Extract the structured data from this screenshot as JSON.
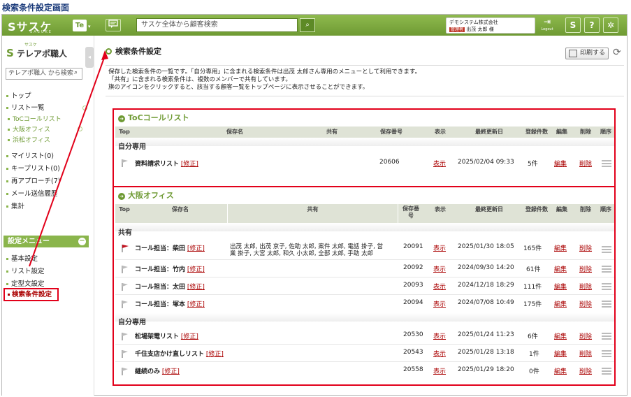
{
  "page_title": "検索条件設定画面",
  "topbar": {
    "logo": "Sサスケ",
    "logo_sub": "SASUKE",
    "te_label": "Te",
    "te_caret": "▾",
    "chat_icon": "chat-icon",
    "search_placeholder": "サスケ全体から顧客検索",
    "search_icon": "⌕",
    "company": "デモシステム株式会社",
    "user_badge": "管理者",
    "user_name": "出茂 太郎 様",
    "logout": "Logout",
    "logout_icon": "⇥",
    "s_icon": "S",
    "help_icon": "?",
    "settings_icon": "✲"
  },
  "sidebar": {
    "app_small": "サスケ",
    "app_name": "テレアポ職人",
    "collapse": "◂",
    "search_placeholder": "テレアポ職人 から検索",
    "items": [
      {
        "label": "トップ"
      },
      {
        "label": "リスト一覧"
      },
      {
        "label": "マイリスト(0)"
      },
      {
        "label": "キープリスト(0)"
      },
      {
        "label": "再アプローチ(7)"
      },
      {
        "label": "メール送信履歴"
      },
      {
        "label": "集計"
      }
    ],
    "sublists": [
      {
        "label": "ToCコールリスト"
      },
      {
        "label": "大阪オフィス"
      },
      {
        "label": "浜松オフィス"
      }
    ],
    "menu_header": "設定メニュー",
    "menu_collapse": "−",
    "menu_items": [
      {
        "label": "基本設定"
      },
      {
        "label": "リスト設定"
      },
      {
        "label": "定型文設定"
      }
    ],
    "active_item": "検索条件設定"
  },
  "main": {
    "heading": "検索条件設定",
    "print_label": "印刷する",
    "refresh_icon": "⟳",
    "desc": [
      "保存した検索条件の一覧です。「自分専用」に含まれる検索条件は出茂 太郎さん専用のメニューとして利用できます。",
      "「共有」に含まれる検索条件は、複数のメンバーで共有しています。",
      "旗のアイコンをクリックすると、該当する顧客一覧をトップページに表示させることができます。"
    ]
  },
  "panel1": {
    "title": "ToCコールリスト",
    "arrow": "➔",
    "headers": [
      "Top",
      "保存名",
      "共有",
      "保存番号",
      "表示",
      "最終更新日",
      "登録件数",
      "編集",
      "削除",
      "順序"
    ],
    "group": "自分専用",
    "rows": [
      {
        "name": "資料請求リスト",
        "edit": "[修正]",
        "shared": "",
        "id": "20606",
        "show": "表示",
        "date": "2025/02/04 09:33",
        "count": "5件",
        "edit_link": "編集",
        "del": "削除",
        "flag": "grey"
      }
    ]
  },
  "panel2": {
    "title": "大阪オフィス",
    "arrow": "➔",
    "headers": [
      "Top",
      "保存名",
      "共有",
      "保存番号",
      "表示",
      "最終更新日",
      "登録件数",
      "編集",
      "削除",
      "順序"
    ],
    "group_shared": "共有",
    "group_own": "自分専用",
    "shared_rows": [
      {
        "name": "コール担当：柴田",
        "edit": "[修正]",
        "shared1": "出茂 太郎, 出茂 京子, 佐助 太郎, 案件 太郎, 電話 掛子, 営",
        "shared2": "業 掛子, 大宮 太郎, 和久 小太郎, 全部 太郎, 手助 太郎",
        "id": "20091",
        "show": "表示",
        "date": "2025/01/30 18:05",
        "count": "165件",
        "edit_link": "編集",
        "del": "削除",
        "flag": "red"
      },
      {
        "name": "コール担当：竹内",
        "edit": "[修正]",
        "shared1": "",
        "shared2": "",
        "id": "20092",
        "show": "表示",
        "date": "2024/09/30 14:20",
        "count": "61件",
        "edit_link": "編集",
        "del": "削除",
        "flag": "grey"
      },
      {
        "name": "コール担当：太田",
        "edit": "[修正]",
        "shared1": "",
        "shared2": "",
        "id": "20093",
        "show": "表示",
        "date": "2024/12/18 18:29",
        "count": "111件",
        "edit_link": "編集",
        "del": "削除",
        "flag": "grey"
      },
      {
        "name": "コール担当：塚本",
        "edit": "[修正]",
        "shared1": "",
        "shared2": "",
        "id": "20094",
        "show": "表示",
        "date": "2024/07/08 10:49",
        "count": "175件",
        "edit_link": "編集",
        "del": "削除",
        "flag": "grey"
      }
    ],
    "own_rows": [
      {
        "name": "松場架電リスト",
        "edit": "[修正]",
        "id": "20530",
        "show": "表示",
        "date": "2025/01/24 11:23",
        "count": "6件",
        "edit_link": "編集",
        "del": "削除",
        "flag": "grey"
      },
      {
        "name": "千住支店かけ直しリスト",
        "edit": "[修正]",
        "id": "20543",
        "show": "表示",
        "date": "2025/01/28 13:18",
        "count": "1件",
        "edit_link": "編集",
        "del": "削除",
        "flag": "grey"
      },
      {
        "name": "継続のみ",
        "edit": "[修正]",
        "id": "20558",
        "show": "表示",
        "date": "2025/01/29 18:20",
        "count": "0件",
        "edit_link": "編集",
        "del": "削除",
        "flag": "grey"
      }
    ]
  },
  "colors": {
    "brand_green": "#6e9a33",
    "highlight_red": "#e2001a",
    "link_red": "#a00000"
  }
}
